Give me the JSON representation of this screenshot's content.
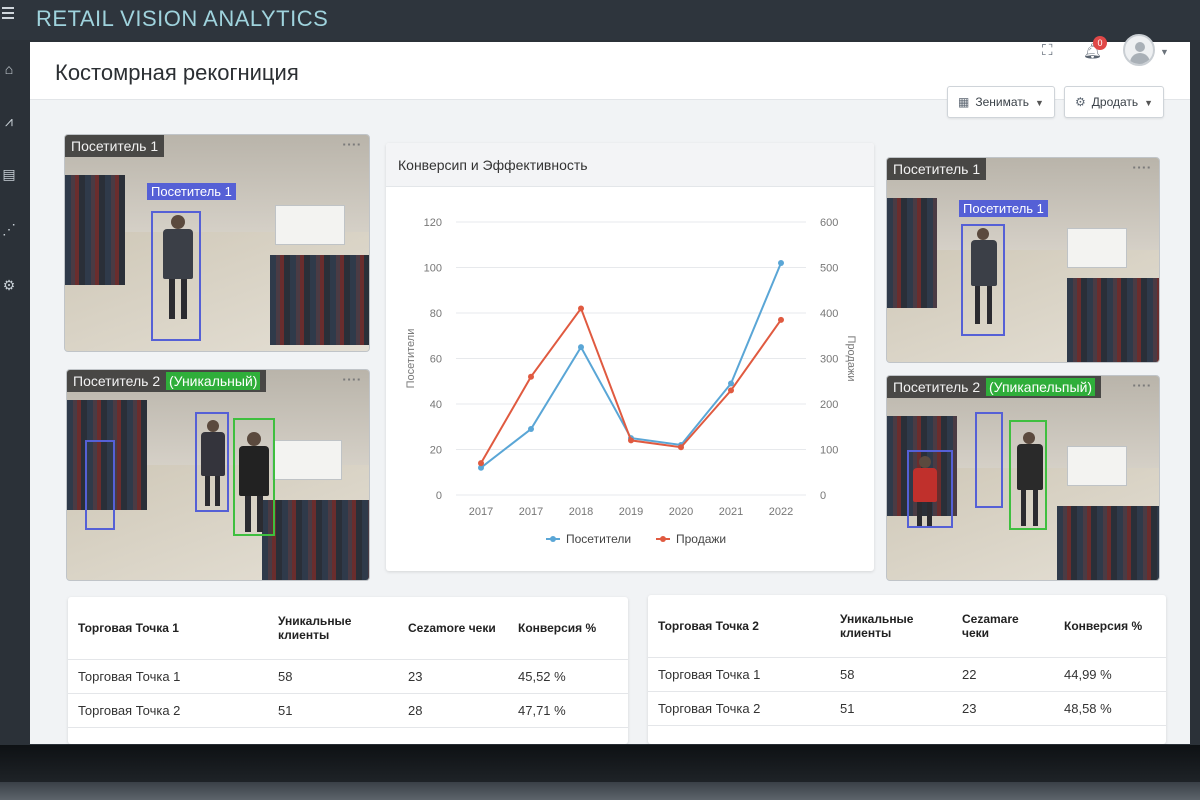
{
  "app": {
    "brand": "RETAIL VISION ANALYTICS"
  },
  "header": {
    "title": "Костомрная рекогниция",
    "notifications_count": "0",
    "btn_period": "Зенимать",
    "btn_sales": "Дродать"
  },
  "cameras": {
    "left_top": {
      "label": "Посетитель 1",
      "tag": "Посетитель 1"
    },
    "left_bottom": {
      "label": "Посетитель 2",
      "unique": "(Уникальный)"
    },
    "right_top": {
      "label": "Посетитель 1",
      "tag": "Посетитель 1"
    },
    "right_bottom": {
      "label": "Посетитель 2",
      "unique": "(Упикапельпый)"
    }
  },
  "chart_data": {
    "type": "line",
    "title": "Конверсип и Эффективность",
    "categories": [
      "2017",
      "2017",
      "2018",
      "2019",
      "2020",
      "2021",
      "2022"
    ],
    "left_axis": {
      "label": "Посетители",
      "ticks": [
        0,
        20,
        40,
        60,
        80,
        100,
        120
      ],
      "ylim": [
        0,
        120
      ]
    },
    "right_axis": {
      "label": "Продажи",
      "ticks": [
        0,
        100,
        200,
        300,
        400,
        500,
        600
      ],
      "ylim": [
        0,
        600
      ]
    },
    "series": [
      {
        "name": "Посетители",
        "axis": "left",
        "color": "#5aa6d6",
        "values": [
          12,
          29,
          65,
          25,
          22,
          49,
          102
        ]
      },
      {
        "name": "Продажи",
        "axis": "right",
        "color": "#e05a40",
        "values": [
          70,
          260,
          410,
          120,
          105,
          230,
          385
        ]
      }
    ],
    "grid": true,
    "legend": "bottom"
  },
  "table1": {
    "headers": [
      "Торговая Точка 1",
      "Уникальные клиенты",
      "Сеzamore чеки",
      "Конверсия %"
    ],
    "rows": [
      [
        "Торговая Точка 1",
        "58",
        "23",
        "45,52 %"
      ],
      [
        "Торговая Точка 2",
        "51",
        "28",
        "47,71 %"
      ]
    ]
  },
  "table2": {
    "headers": [
      "Торговая Точка 2",
      "Уникальные клиенты",
      "Сеzamare чеки",
      "Конверсия %"
    ],
    "rows": [
      [
        "Торговая Точка 1",
        "58",
        "22",
        "44,99 %"
      ],
      [
        "Торговая Точка 2",
        "51",
        "23",
        "48,58 %"
      ]
    ]
  }
}
